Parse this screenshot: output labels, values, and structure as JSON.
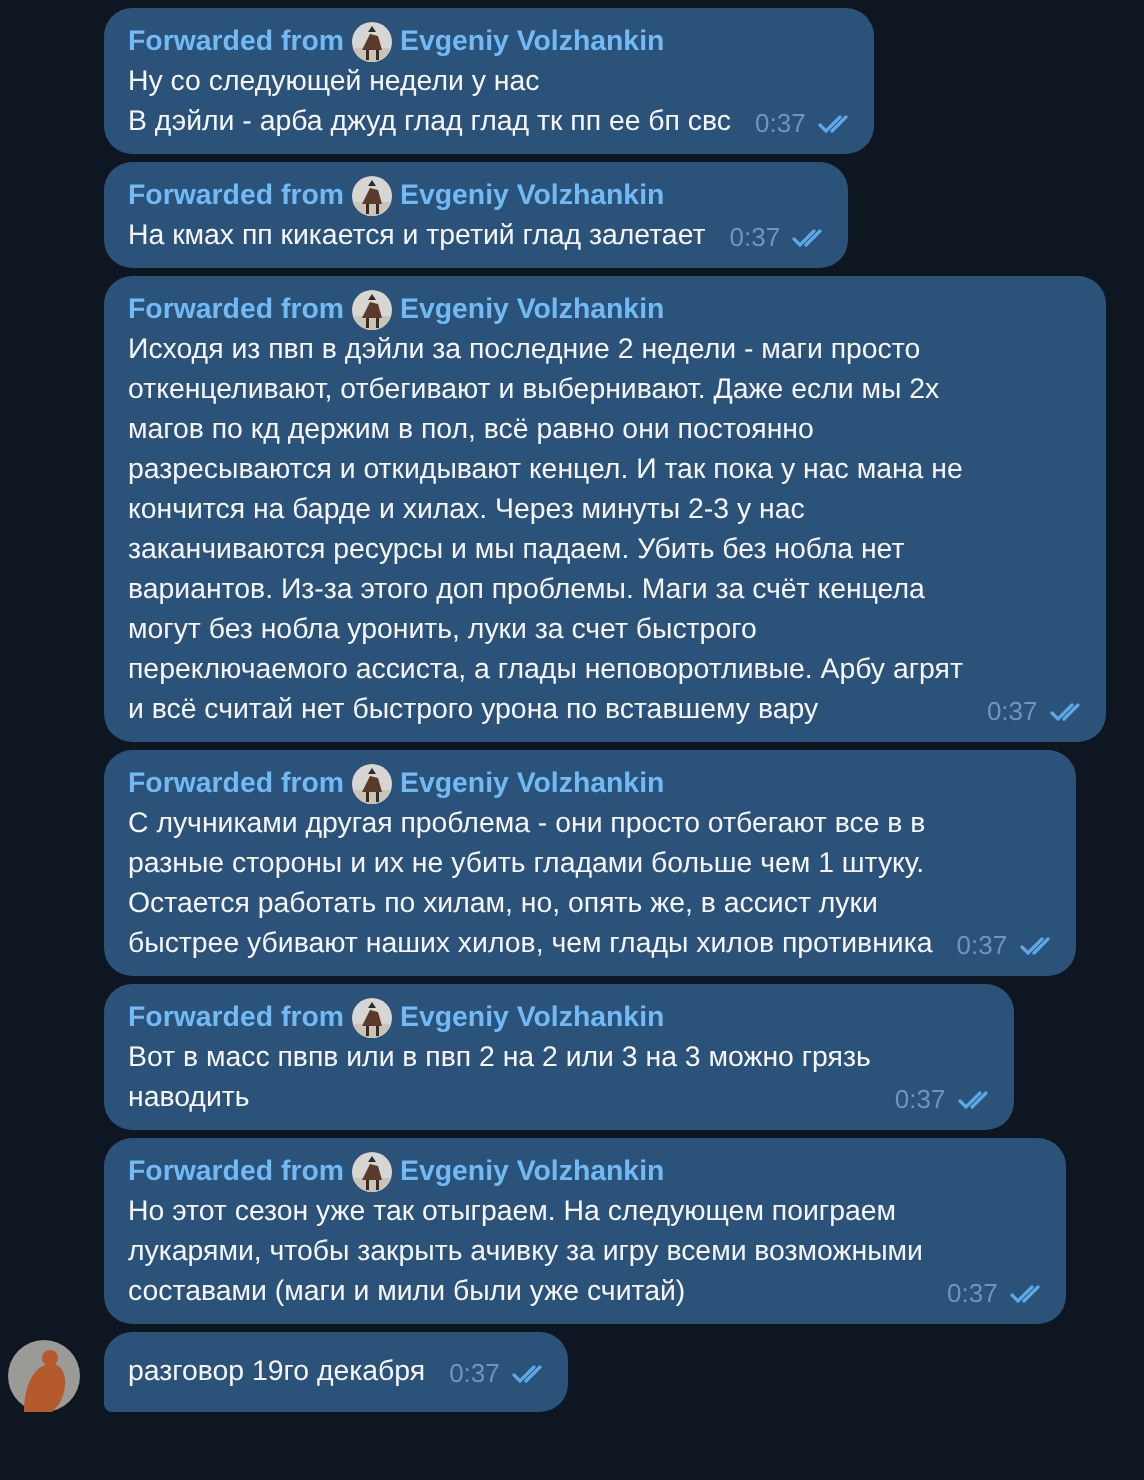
{
  "messages": [
    {
      "forwarded_label": "Forwarded from",
      "forwarded_name": "Evgeniy Volzhankin",
      "text": "Ну со следующей недели у нас\nВ дэйли - арба джуд глад глад тк пп ее бп свс",
      "time": "0:37",
      "read": true,
      "show_avatar": false
    },
    {
      "forwarded_label": "Forwarded from",
      "forwarded_name": "Evgeniy Volzhankin",
      "text": "На кмах пп кикается и третий глад залетает",
      "time": "0:37",
      "read": true,
      "show_avatar": false
    },
    {
      "forwarded_label": "Forwarded from",
      "forwarded_name": "Evgeniy Volzhankin",
      "text": "Исходя из пвп в дэйли за последние 2 недели - маги просто\nоткенцеливают, отбегивают и выбернивают. Даже если мы 2х\nмагов по кд держим в пол, всё равно они постоянно\nразресываются и откидывают кенцел. И так пока у нас мана не\nкончится на барде и хилах. Через минуты 2-3 у нас\nзаканчиваются ресурсы и мы падаем. Убить без нобла нет\nвариантов. Из-за этого доп проблемы. Маги за счёт кенцела\nмогут без нобла уронить, луки за счет быстрого\nпереключаемого ассиста, а глады неповоротливые. Арбу агрят\nи всё считай нет быстрого урона по вставшему вару",
      "time": "0:37",
      "read": true,
      "show_avatar": false
    },
    {
      "forwarded_label": "Forwarded from",
      "forwarded_name": "Evgeniy Volzhankin",
      "text": "С лучниками другая проблема - они просто отбегают все в в\nразные стороны и их не убить гладами больше чем 1 штуку.\nОстается работать по хилам, но, опять же,  в ассист луки\nбыстрее убивают наших хилов, чем глады хилов противника",
      "time": "0:37",
      "read": true,
      "show_avatar": false
    },
    {
      "forwarded_label": "Forwarded from",
      "forwarded_name": "Evgeniy Volzhankin",
      "text": "Вот в масс пвпв или в пвп 2 на 2 или 3 на 3 можно грязь\nнаводить",
      "time": "0:37",
      "read": true,
      "show_avatar": false
    },
    {
      "forwarded_label": "Forwarded from",
      "forwarded_name": "Evgeniy Volzhankin",
      "text": "Но этот сезон уже так отыграем. На следующем поиграем\nлукарями, чтобы закрыть ачивку за игру всеми возможными\nсоставами (маги и мили были уже считай)",
      "time": "0:37",
      "read": true,
      "show_avatar": false
    },
    {
      "text": "разговор 19го декабря",
      "time": "0:37",
      "read": true,
      "show_avatar": true
    }
  ]
}
